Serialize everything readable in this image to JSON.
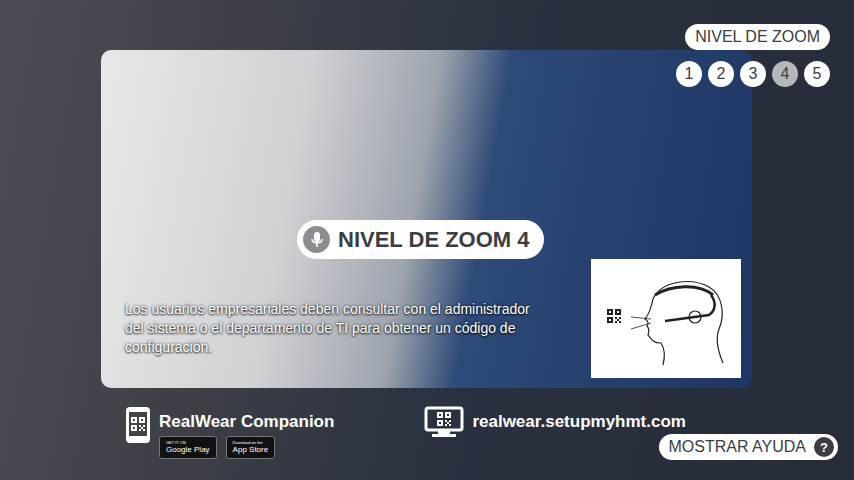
{
  "zoom_panel": {
    "title": "NIVEL DE ZOOM",
    "levels": [
      {
        "label": "1",
        "selected": false
      },
      {
        "label": "2",
        "selected": false
      },
      {
        "label": "3",
        "selected": false
      },
      {
        "label": "4",
        "selected": true
      },
      {
        "label": "5",
        "selected": false
      }
    ]
  },
  "zoom_badge": {
    "label": "NIVEL DE ZOOM 4"
  },
  "card": {
    "message": "Los usuarios empresariales deben consultar con el administrador del sistema o el departamento de TI para obtener un código de configuración."
  },
  "companion": {
    "title": "RealWear Companion",
    "stores": [
      {
        "small": "GET IT ON",
        "name": "Google Play"
      },
      {
        "small": "Download on the",
        "name": "App Store"
      }
    ]
  },
  "setup": {
    "url": "realwear.setupmyhmt.com"
  },
  "help": {
    "label": "MOSTRAR AYUDA",
    "icon": "?"
  }
}
